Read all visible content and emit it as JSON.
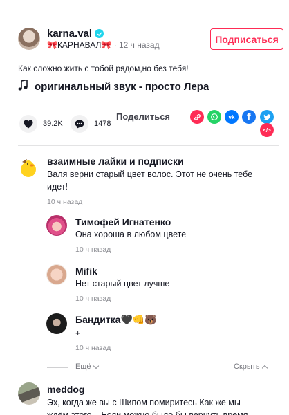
{
  "post": {
    "author_name": "karna.val",
    "author_subtitle": "🎀КАРНАВАЛ🎀",
    "time": "12 ч назад",
    "follow_label": "Подписаться",
    "description": "Как сложно жить с тобой рядом,но без тебя!",
    "music": "оригинальный звук - просто Лера",
    "likes": "39.2K",
    "comments": "1478",
    "share_label": "Поделиться"
  },
  "comments": [
    {
      "author": "взаимные лайки и подписки",
      "text_line1": "Валя верни старый цвет волос. Этот не очень тебе",
      "text_line2": "идет!",
      "time": "10 ч назад",
      "replies": [
        {
          "author": "Тимофей Игнатенко",
          "text": "Она хороша в любом цвете",
          "time": "10 ч назад"
        },
        {
          "author": "Mifik",
          "text": "Нет старый цвет лучше",
          "time": "10 ч назад"
        },
        {
          "author": "Бандитка🖤👊🐻",
          "text": "+",
          "time": "10 ч назад"
        }
      ],
      "more_label": "Ещё",
      "hide_label": "Скрыть"
    },
    {
      "author": "meddog",
      "text_line1": "Эх, когда же вы с Шипом помиритесь Как же мы",
      "text_line2": "ждём этого... Если можно было бы вернуть время"
    }
  ],
  "colors": {
    "accent": "#fe2c55",
    "verified": "#20d5ec",
    "text": "#161823",
    "whatsapp": "#25d366",
    "vk": "#0077ff",
    "facebook": "#1877f2",
    "twitter": "#1da1f2",
    "link": "#fe2c55",
    "embed": "#fe2c55"
  },
  "icons": [
    "verified-icon",
    "music-note-icon",
    "heart-icon",
    "comment-icon",
    "link-icon",
    "whatsapp-icon",
    "vk-icon",
    "facebook-icon",
    "twitter-icon",
    "embed-icon",
    "chevron-down-icon",
    "chevron-up-icon"
  ]
}
